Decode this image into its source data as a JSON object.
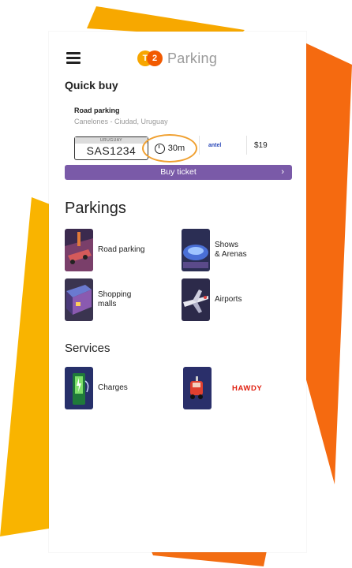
{
  "app": {
    "brand_logo_text_1": "T",
    "brand_logo_text_2": "2",
    "brand_name": "Parking",
    "brand_colors": [
      "#f7a600",
      "#f25a00"
    ]
  },
  "quick_buy": {
    "title": "Quick buy",
    "place": "Road parking",
    "location": "Canelones - Ciudad, Uruguay",
    "plate_country": "URUGUAY",
    "plate_number": "SAS1234",
    "duration": "30m",
    "provider": "antel",
    "price": "$19",
    "buy_label": "Buy ticket",
    "buy_chevron": "›",
    "accent_color": "#7a5aa8"
  },
  "parkings": {
    "title": "Parkings",
    "items": [
      {
        "label_1": "Road parking",
        "label_2": "",
        "icon": "road-parking-icon"
      },
      {
        "label_1": "Shows",
        "label_2": "& Arenas",
        "icon": "shows-arenas-icon"
      },
      {
        "label_1": "Shopping",
        "label_2": "malls",
        "icon": "shopping-malls-icon"
      },
      {
        "label_1": "Airports",
        "label_2": "",
        "icon": "airports-icon"
      }
    ]
  },
  "services": {
    "title": "Services",
    "items": [
      {
        "label": "Charges",
        "icon": "charging-station-icon"
      },
      {
        "label": "HAWDY",
        "icon": "hawdy-icon"
      }
    ]
  }
}
